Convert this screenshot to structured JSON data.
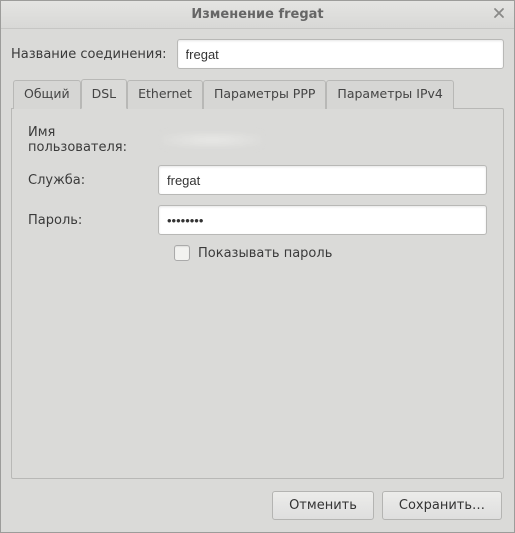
{
  "window": {
    "title": "Изменение fregat"
  },
  "connection": {
    "name_label": "Название соединения:",
    "name_value": "fregat"
  },
  "tabs": {
    "items": [
      {
        "label": "Общий"
      },
      {
        "label": "DSL"
      },
      {
        "label": "Ethernet"
      },
      {
        "label": "Параметры PPP"
      },
      {
        "label": "Параметры IPv4"
      }
    ],
    "active_index": 1
  },
  "dsl": {
    "username_label": "Имя пользователя:",
    "username_value": "",
    "service_label": "Служба:",
    "service_value": "fregat",
    "password_label": "Пароль:",
    "password_value": "••••••••",
    "show_password_label": "Показывать пароль",
    "show_password_checked": false
  },
  "buttons": {
    "cancel": "Отменить",
    "save": "Сохранить…"
  }
}
